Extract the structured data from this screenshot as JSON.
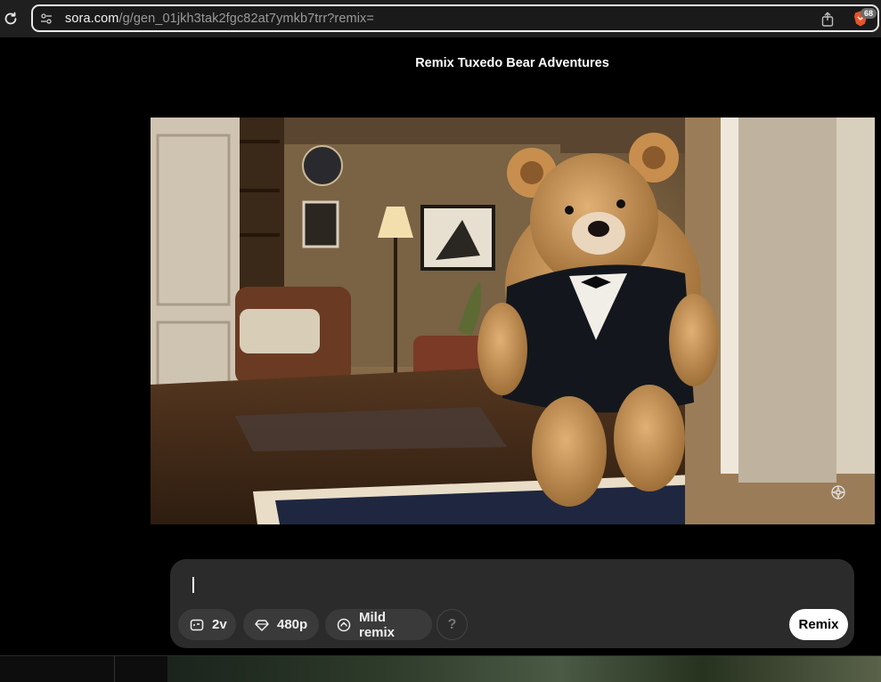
{
  "browser": {
    "url_host": "sora.com",
    "url_path": "/g/gen_01jkh3tak2fgc82at7ymkb7trr?remix=",
    "badge_count": "68"
  },
  "page": {
    "title": "Remix Tuxedo Bear Adventures"
  },
  "composer": {
    "prompt_value": "",
    "variations_label": "2v",
    "resolution_label": "480p",
    "remix_strength_label": "Mild remix",
    "help_label": "?",
    "submit_label": "Remix"
  },
  "colors": {
    "background": "#000000",
    "composer_bg": "#2b2b2b",
    "chip_bg": "#3a3a3a",
    "submit_bg": "#ffffff",
    "brave_orange": "#e8532a"
  }
}
